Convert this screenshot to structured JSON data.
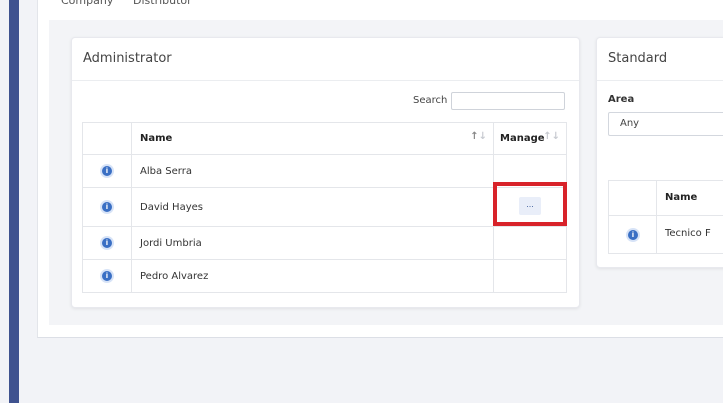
{
  "tabs": [
    "Company",
    "Distributor"
  ],
  "admin": {
    "title": "Administrator",
    "search_label": "Search",
    "search_value": "",
    "columns": {
      "name": "Name",
      "manage": "Manage"
    },
    "rows": [
      {
        "name": "Alba Serra"
      },
      {
        "name": "David Hayes",
        "manage_label": "..."
      },
      {
        "name": "Jordi Umbria"
      },
      {
        "name": "Pedro Alvarez"
      }
    ]
  },
  "standard": {
    "title": "Standard",
    "area_label": "Area",
    "area_value": "Any",
    "columns": {
      "name": "Name"
    },
    "rows": [
      {
        "name": "Tecnico F"
      }
    ]
  },
  "colors": {
    "sidebar": "#3f528f",
    "info_icon": "#3a6fc4",
    "highlight": "#d8232a"
  }
}
